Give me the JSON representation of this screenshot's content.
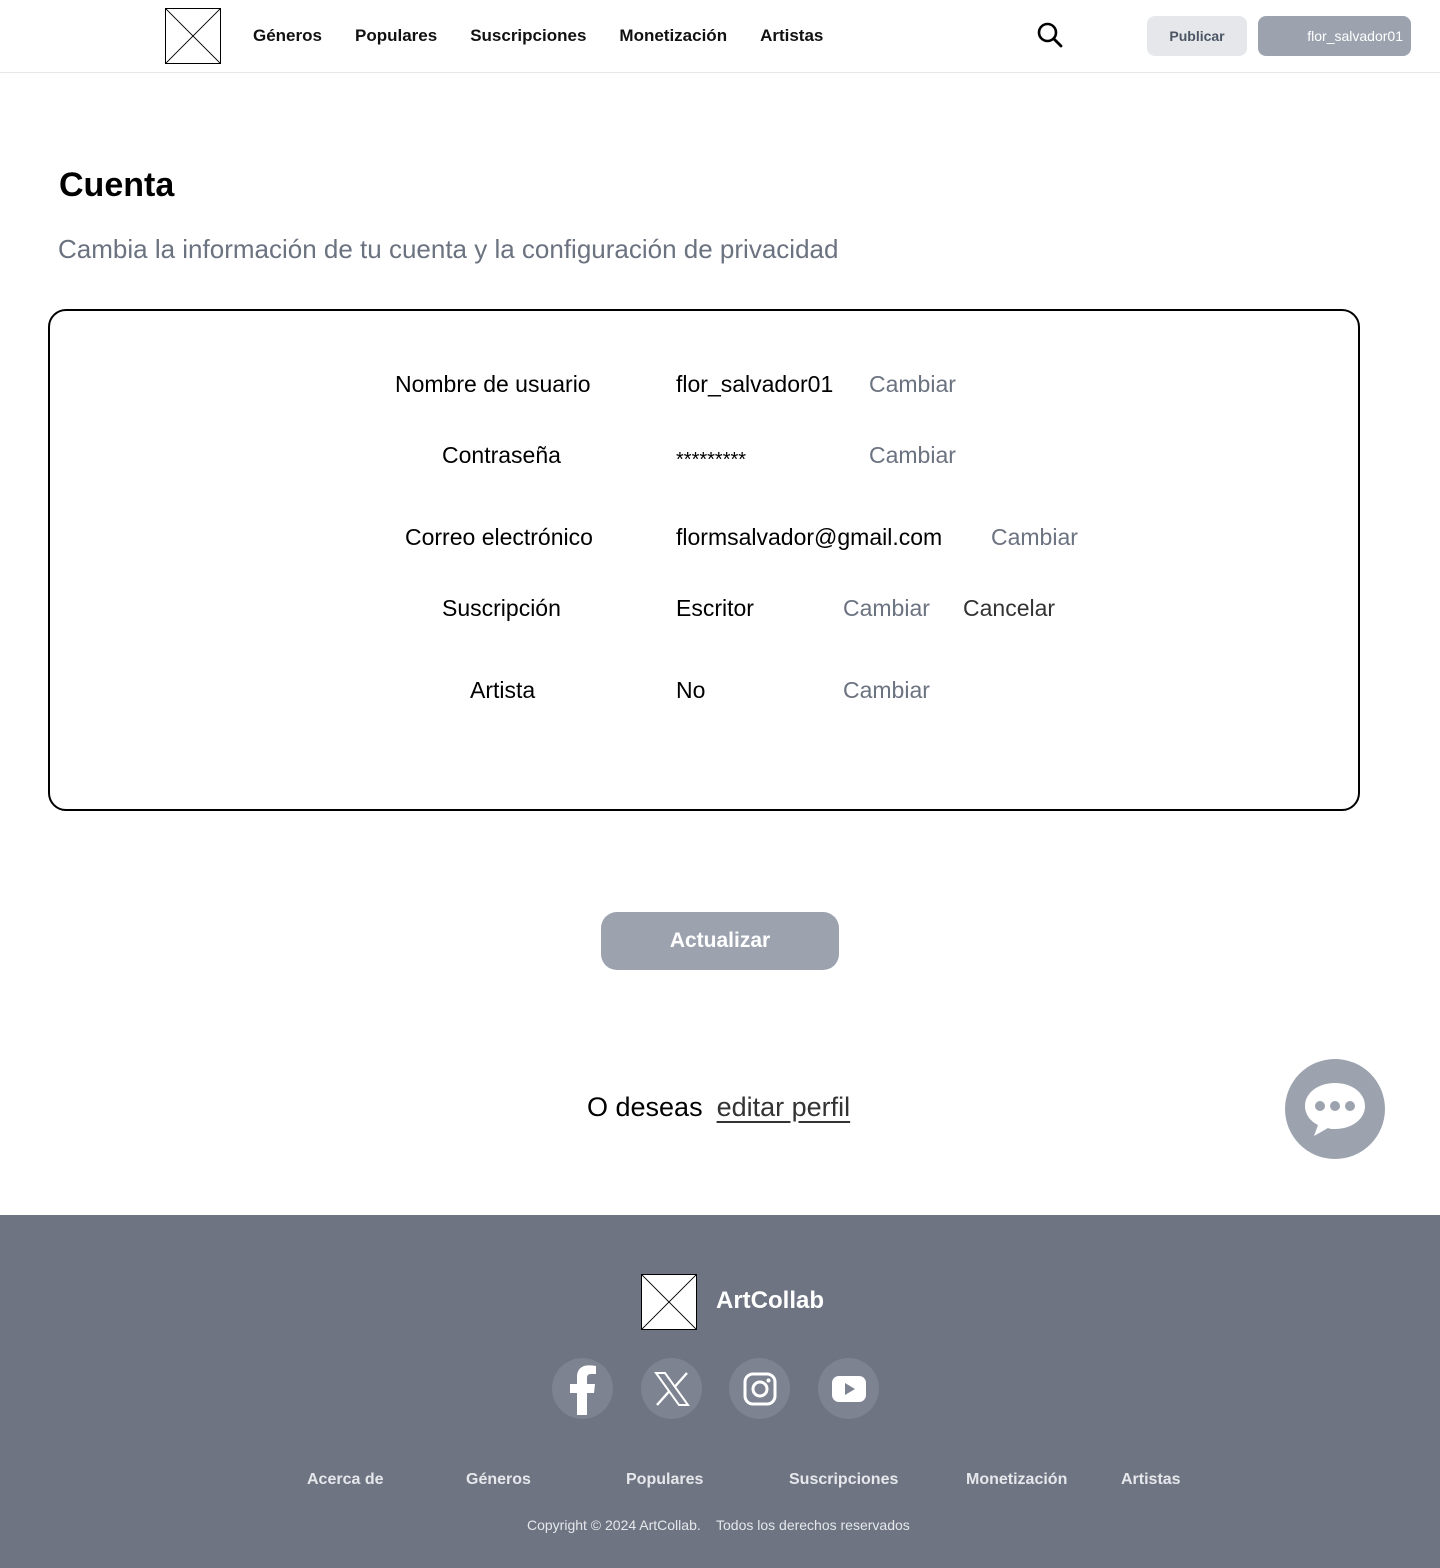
{
  "header": {
    "logo_icon": "placeholder-image-icon",
    "nav": [
      "Géneros",
      "Populares",
      "Suscripciones",
      "Monetización",
      "Artistas"
    ],
    "search_icon": "search-icon",
    "publish_label": "Publicar",
    "user_label": "flor_salvador01"
  },
  "page": {
    "title": "Cuenta",
    "subtitle": "Cambia la información de tu cuenta y la configuración de privacidad"
  },
  "account": {
    "username": {
      "label": "Nombre de usuario",
      "value": "flor_salvador01",
      "action": "Cambiar"
    },
    "password": {
      "label": "Contraseña",
      "value": "*********",
      "action": "Cambiar"
    },
    "email": {
      "label": "Correo electrónico",
      "value": "flormsalvador@gmail.com",
      "action": "Cambiar"
    },
    "subscription": {
      "label": "Suscripción",
      "value": "Escritor",
      "action": "Cambiar",
      "cancel": "Cancelar"
    },
    "artist": {
      "label": "Artista",
      "value": "No",
      "action": "Cambiar"
    }
  },
  "update_label": "Actualizar",
  "alt": {
    "text": "O deseas",
    "link": "editar perfil"
  },
  "chat_icon": "chat-bubble-icon",
  "footer": {
    "brand": "ArtCollab",
    "social_icons": [
      "facebook-icon",
      "x-icon",
      "instagram-icon",
      "youtube-icon"
    ],
    "links": [
      "Acerca de",
      "Géneros",
      "Populares",
      "Suscripciones",
      "Monetización",
      "Artistas"
    ],
    "copyright": "Copyright © 2024 ArtCollab.",
    "rights": "Todos los derechos reservados"
  },
  "colors": {
    "footer_bg": "#6e7482",
    "button_gray": "#9ca3af",
    "muted_text": "#6b7280"
  }
}
